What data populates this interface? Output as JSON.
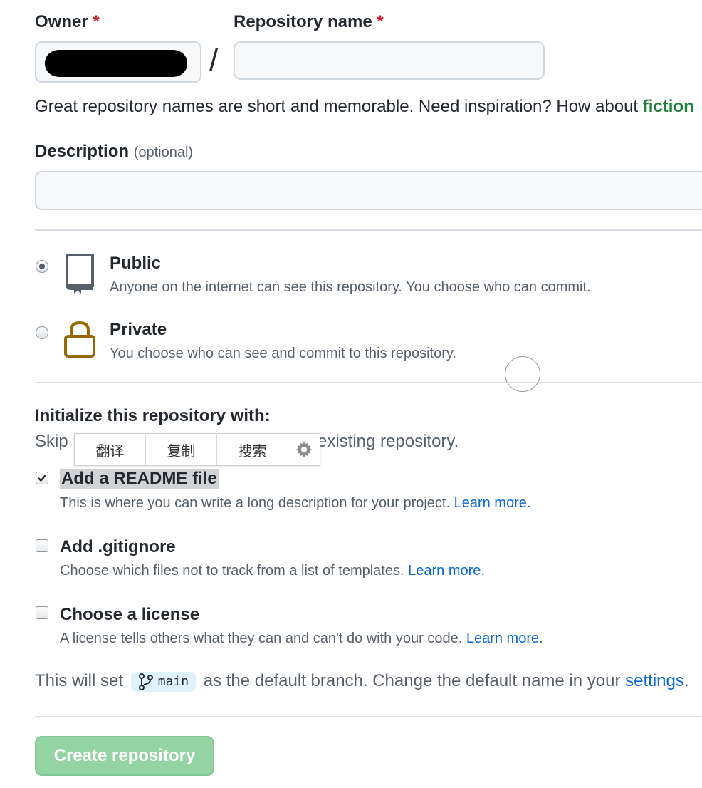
{
  "owner": {
    "label": "Owner",
    "required_mark": "*"
  },
  "separator": "/",
  "repo_name": {
    "label": "Repository name",
    "required_mark": "*",
    "value": ""
  },
  "hint": {
    "text": "Great repository names are short and memorable. Need inspiration? How about ",
    "suggestion": "fiction"
  },
  "description": {
    "label": "Description",
    "optional": "(optional)",
    "value": ""
  },
  "visibility": {
    "public": {
      "title": "Public",
      "desc": "Anyone on the internet can see this repository. You choose who can commit.",
      "icon": "repo-icon"
    },
    "private": {
      "title": "Private",
      "desc": "You choose who can see and commit to this repository.",
      "icon": "lock-icon"
    }
  },
  "init": {
    "heading": "Initialize this repository with:",
    "skip_start": "Skip",
    "skip_end": "existing repository.",
    "readme": {
      "label": "Add a README file",
      "desc": "This is where you can write a long description for your project.",
      "link": "Learn more."
    },
    "gitignore": {
      "label": "Add .gitignore",
      "desc": "Choose which files not to track from a list of templates.",
      "link": "Learn more."
    },
    "license": {
      "label": "Choose a license",
      "desc": "A license tells others what they can and can't do with your code.",
      "link": "Learn more."
    }
  },
  "branch_note": {
    "prefix": "This will set",
    "branch": "main",
    "middle": "as the default branch. Change the default name in your",
    "link": "settings",
    "suffix": "."
  },
  "popup_toolbar": {
    "translate": "翻译",
    "copy": "复制",
    "search": "搜索",
    "icon": "gear-icon"
  },
  "create_button": "Create repository",
  "colors": {
    "accent_green": "#1a7f37",
    "link_blue": "#0969da",
    "button_green_disabled": "#94d3a2",
    "lock_brown": "#9a6700"
  }
}
